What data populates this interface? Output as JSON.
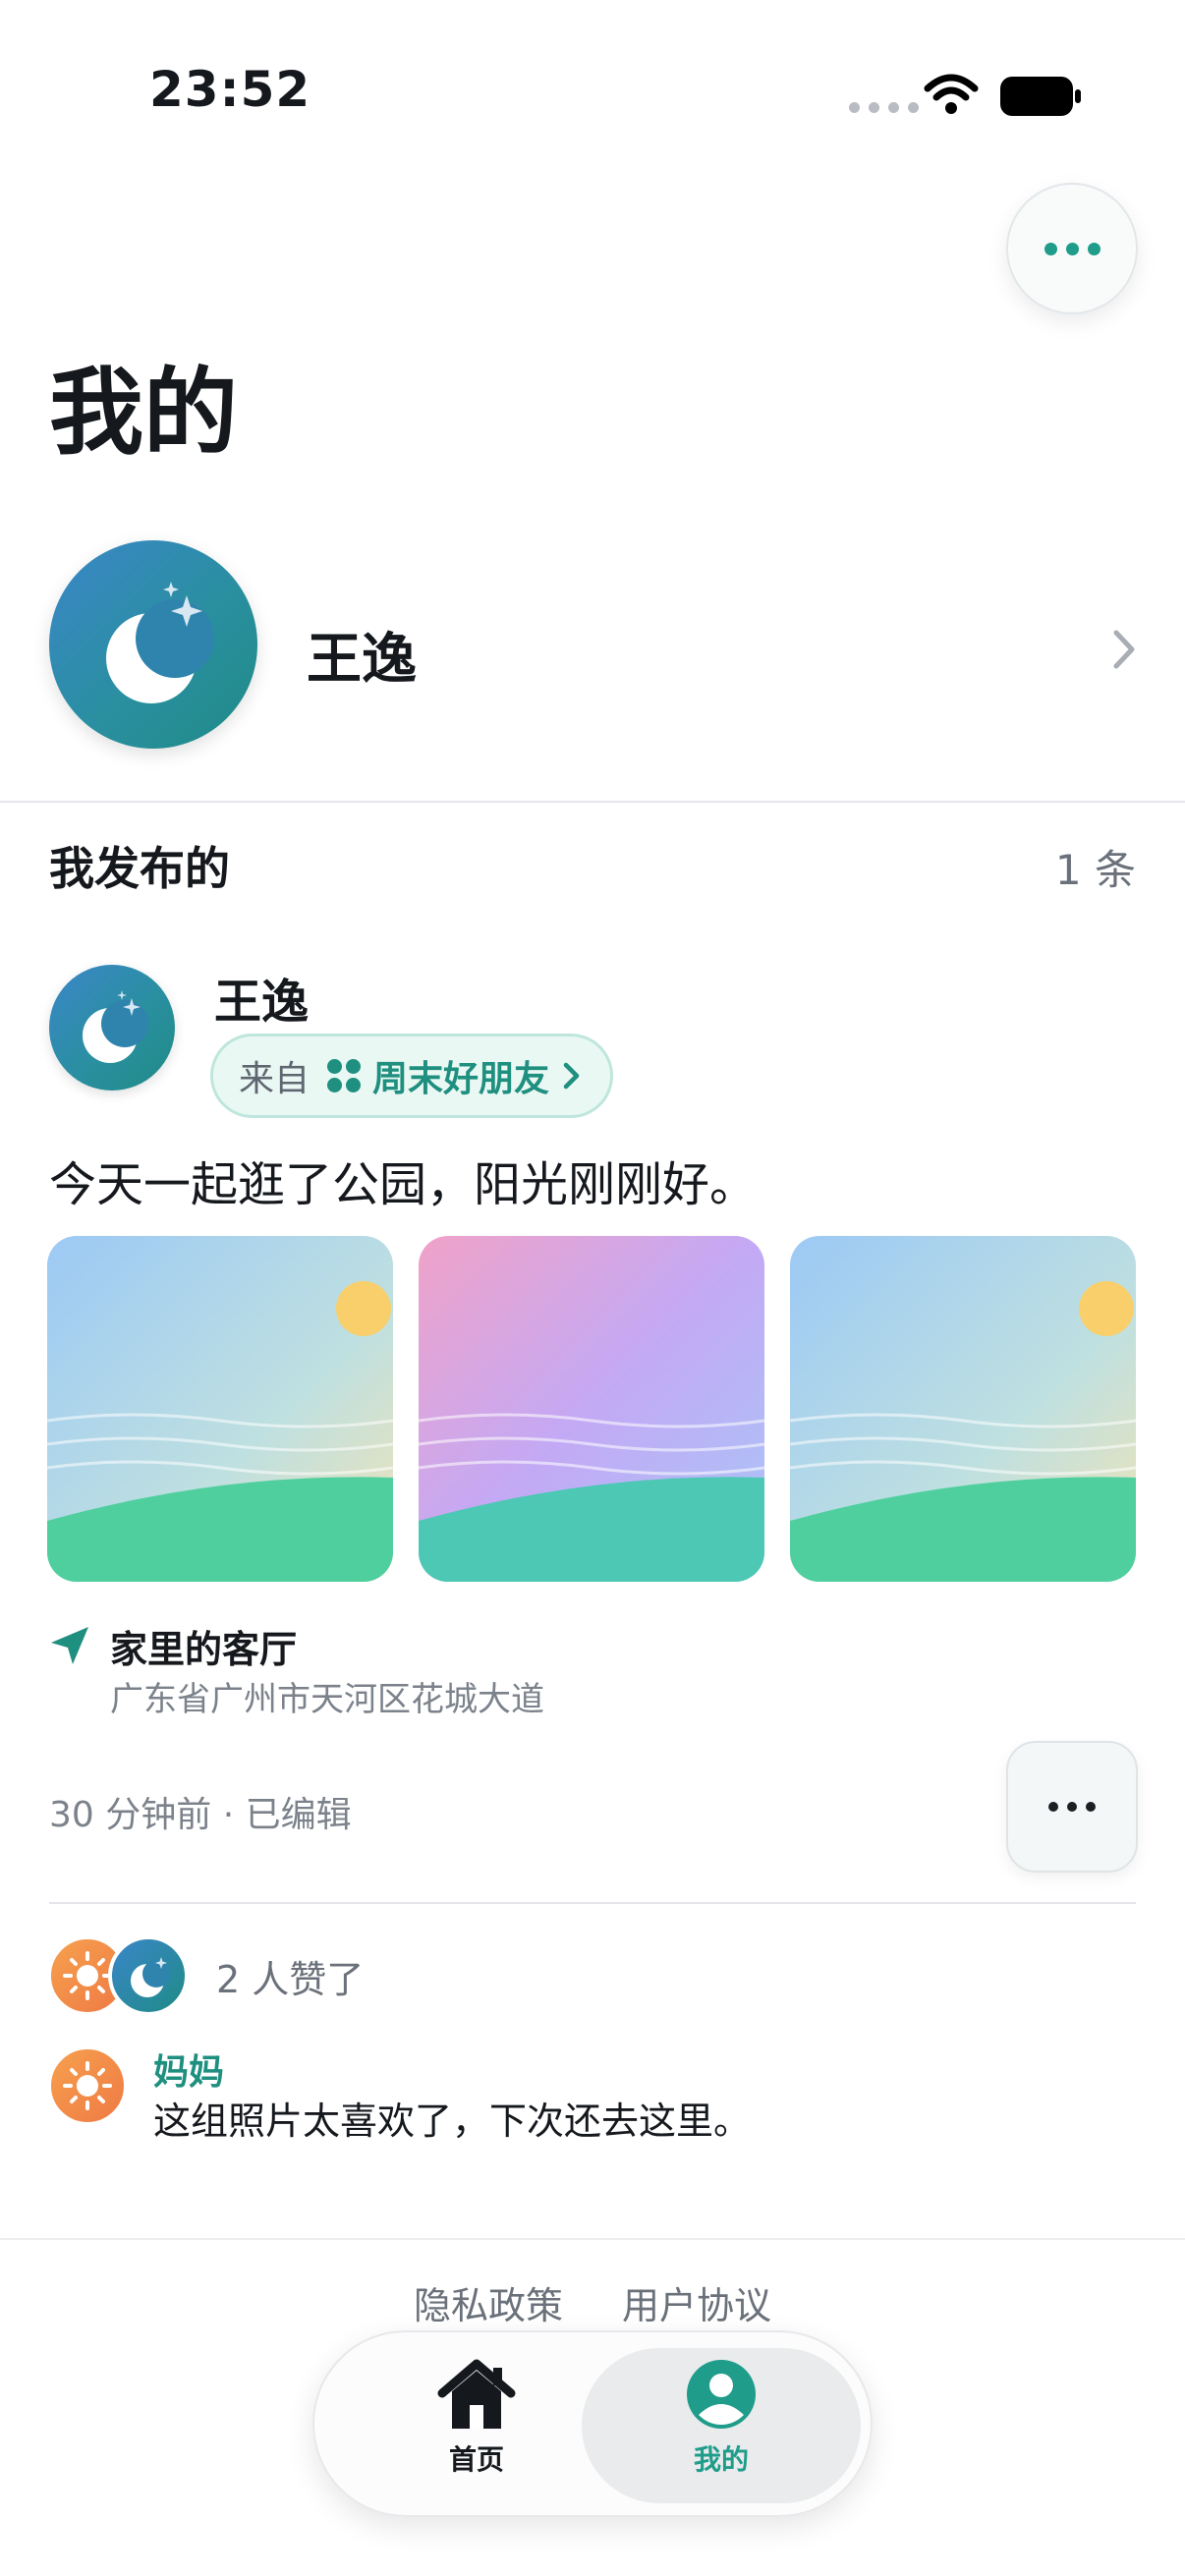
{
  "status_bar": {
    "time": "23:52"
  },
  "page": {
    "title": "我的"
  },
  "profile": {
    "name": "王逸"
  },
  "posts_section": {
    "title": "我发布的",
    "count": "1 条"
  },
  "post": {
    "author": "王逸",
    "from_label": "来自",
    "group_name": "周末好朋友",
    "text": "今天一起逛了公园，阳光刚刚好。",
    "location_name": "家里的客厅",
    "location_address": "广东省广州市天河区花城大道",
    "meta": "30 分钟前 · 已编辑",
    "likes": "2 人赞了",
    "comment": {
      "author": "妈妈",
      "text": "这组照片太喜欢了，下次还去这里。"
    }
  },
  "footer": {
    "privacy": "隐私政策",
    "terms": "用户协议"
  },
  "tabbar": {
    "home": "首页",
    "me": "我的"
  },
  "colors": {
    "accent": "#1f9c8a",
    "text": "#15181d",
    "muted": "#6b717a"
  },
  "icons": [
    "signal-dots-icon",
    "wifi-icon",
    "battery-icon",
    "more-icon",
    "moon-avatar-icon",
    "chevron-right-icon",
    "group-icon",
    "location-arrow-icon",
    "sun-avatar-icon",
    "home-icon",
    "person-icon"
  ]
}
